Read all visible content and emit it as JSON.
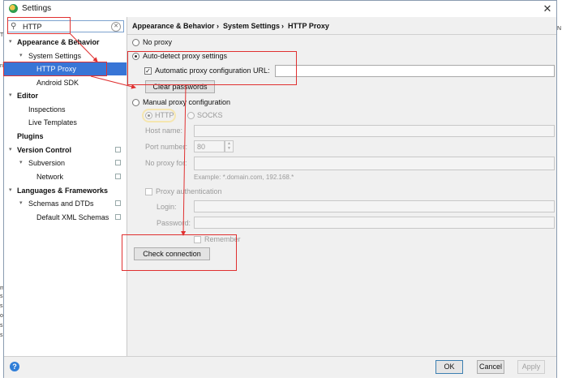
{
  "window": {
    "title": "Settings",
    "close_label": "✕"
  },
  "search": {
    "value": "HTTP"
  },
  "tree": [
    {
      "label": "Appearance & Behavior",
      "bold": true,
      "level": 0,
      "expanded": true
    },
    {
      "label": "System Settings",
      "bold": false,
      "level": 1,
      "expanded": true
    },
    {
      "label": "HTTP Proxy",
      "bold": false,
      "level": 2,
      "selected": true
    },
    {
      "label": "Android SDK",
      "bold": false,
      "level": 2
    },
    {
      "label": "Editor",
      "bold": true,
      "level": 0,
      "expanded": true
    },
    {
      "label": "Inspections",
      "bold": false,
      "level": 1
    },
    {
      "label": "Live Templates",
      "bold": false,
      "level": 1
    },
    {
      "label": "Plugins",
      "bold": true,
      "level": 0
    },
    {
      "label": "Version Control",
      "bold": true,
      "level": 0,
      "expanded": true,
      "project_icon": true
    },
    {
      "label": "Subversion",
      "bold": false,
      "level": 1,
      "expanded": true,
      "project_icon": true
    },
    {
      "label": "Network",
      "bold": false,
      "level": 2,
      "project_icon": true
    },
    {
      "label": "Languages & Frameworks",
      "bold": true,
      "level": 0,
      "expanded": true
    },
    {
      "label": "Schemas and DTDs",
      "bold": false,
      "level": 1,
      "expanded": true,
      "project_icon": true
    },
    {
      "label": "Default XML Schemas",
      "bold": false,
      "level": 2,
      "project_icon": true
    }
  ],
  "breadcrumb": {
    "part1": "Appearance & Behavior",
    "sep": "›",
    "part2": "System Settings",
    "part3": "HTTP Proxy"
  },
  "proxy": {
    "no_proxy": "No proxy",
    "auto_detect": "Auto-detect proxy settings",
    "auto_config_url": "Automatic proxy configuration URL:",
    "clear_passwords": "Clear passwords",
    "manual": "Manual proxy configuration",
    "http": "HTTP",
    "socks": "SOCKS",
    "host_name": "Host name:",
    "port_number": "Port number:",
    "port_value": "80",
    "no_proxy_for": "No proxy for:",
    "example": "Example: *.domain.com, 192.168.*",
    "proxy_auth": "Proxy authentication",
    "login": "Login:",
    "password": "Password:",
    "remember": "Remember",
    "check_connection": "Check connection"
  },
  "footer": {
    "ok": "OK",
    "cancel": "Cancel",
    "apply": "Apply",
    "help": "?"
  },
  "background_fragments": [
    "m",
    "s,",
    "s",
    "o",
    "s",
    "s"
  ],
  "background_right_fragments": [
    "N",
    "",
    "",
    "",
    ""
  ],
  "background_top_left": [
    "T",
    "ri"
  ],
  "colors": {
    "selection": "#3875d6",
    "annotation_red": "#e03030",
    "help_blue": "#2f7ed8"
  }
}
